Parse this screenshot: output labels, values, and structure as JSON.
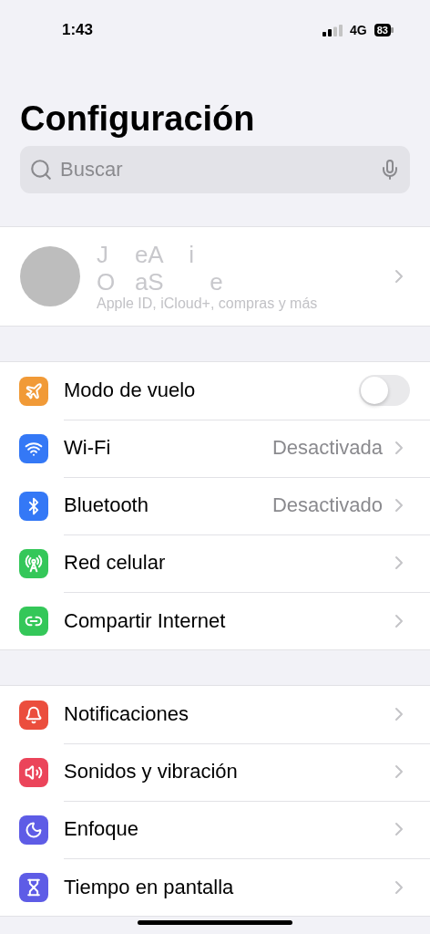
{
  "status_bar": {
    "time": "1:43",
    "network": "4G",
    "battery": "83"
  },
  "title": "Configuración",
  "search": {
    "placeholder": "Buscar"
  },
  "profile": {
    "name_line_1": "J    eA    i",
    "name_line_2": "O   aS       e",
    "subtitle": "Apple ID, iCloud+, compras y más"
  },
  "groups": [
    {
      "items": [
        {
          "label": "Modo de vuelo",
          "kind": "toggle",
          "on": false,
          "color": "#f19a37"
        },
        {
          "label": "Wi-Fi",
          "kind": "link",
          "value": "Desactivada",
          "color": "#3478f6"
        },
        {
          "label": "Bluetooth",
          "kind": "link",
          "value": "Desactivado",
          "color": "#3478f6"
        },
        {
          "label": "Red celular",
          "kind": "link",
          "color": "#34c759"
        },
        {
          "label": "Compartir Internet",
          "kind": "link",
          "color": "#34c759"
        }
      ]
    },
    {
      "items": [
        {
          "label": "Notificaciones",
          "kind": "link",
          "color": "#eb4e3d"
        },
        {
          "label": "Sonidos y vibración",
          "kind": "link",
          "color": "#eb445a"
        },
        {
          "label": "Enfoque",
          "kind": "link",
          "color": "#5e5ce6"
        },
        {
          "label": "Tiempo en pantalla",
          "kind": "link",
          "color": "#5e5ce6"
        }
      ]
    }
  ]
}
